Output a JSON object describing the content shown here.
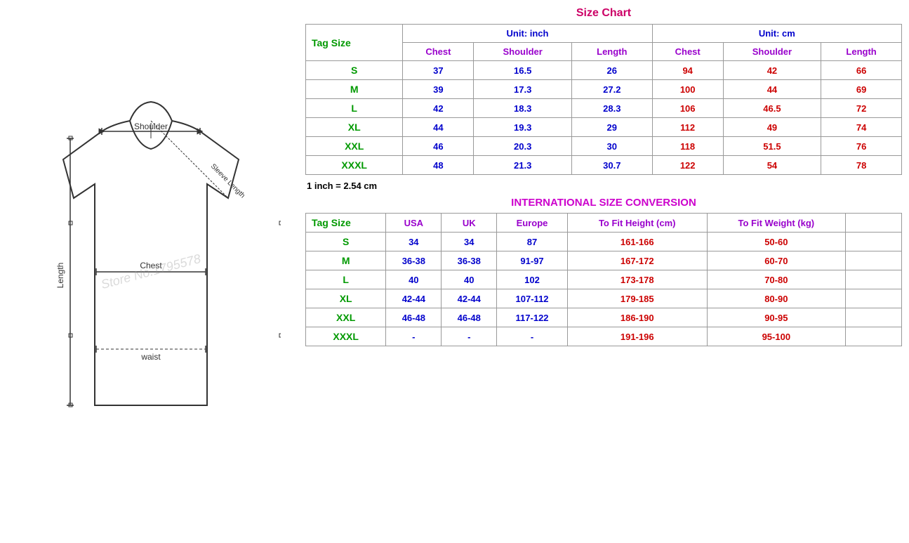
{
  "left": {
    "diagram_alt": "T-shirt size diagram"
  },
  "right": {
    "size_chart_title": "Size Chart",
    "unit_inch": "Unit: inch",
    "unit_cm": "Unit: cm",
    "tag_size_label": "Tag Size",
    "inch_note": "1 inch = 2.54 cm",
    "columns_inch": [
      "Chest",
      "Shoulder",
      "Length"
    ],
    "columns_cm": [
      "Chest",
      "Shoulder",
      "Length"
    ],
    "size_rows": [
      {
        "tag": "S",
        "chest_in": "37",
        "shoulder_in": "16.5",
        "length_in": "26",
        "chest_cm": "94",
        "shoulder_cm": "42",
        "length_cm": "66"
      },
      {
        "tag": "M",
        "chest_in": "39",
        "shoulder_in": "17.3",
        "length_in": "27.2",
        "chest_cm": "100",
        "shoulder_cm": "44",
        "length_cm": "69"
      },
      {
        "tag": "L",
        "chest_in": "42",
        "shoulder_in": "18.3",
        "length_in": "28.3",
        "chest_cm": "106",
        "shoulder_cm": "46.5",
        "length_cm": "72"
      },
      {
        "tag": "XL",
        "chest_in": "44",
        "shoulder_in": "19.3",
        "length_in": "29",
        "chest_cm": "112",
        "shoulder_cm": "49",
        "length_cm": "74"
      },
      {
        "tag": "XXL",
        "chest_in": "46",
        "shoulder_in": "20.3",
        "length_in": "30",
        "chest_cm": "118",
        "shoulder_cm": "51.5",
        "length_cm": "76"
      },
      {
        "tag": "XXXL",
        "chest_in": "48",
        "shoulder_in": "21.3",
        "length_in": "30.7",
        "chest_cm": "122",
        "shoulder_cm": "54",
        "length_cm": "78"
      }
    ],
    "intl_title": "INTERNATIONAL SIZE CONVERSION",
    "intl_columns": [
      "USA",
      "UK",
      "Europe",
      "To Fit Height (cm)",
      "To Fit Weight (kg)"
    ],
    "intl_rows": [
      {
        "tag": "S",
        "usa": "34",
        "uk": "34",
        "europe": "87",
        "height": "161-166",
        "weight": "50-60"
      },
      {
        "tag": "M",
        "usa": "36-38",
        "uk": "36-38",
        "europe": "91-97",
        "height": "167-172",
        "weight": "60-70"
      },
      {
        "tag": "L",
        "usa": "40",
        "uk": "40",
        "europe": "102",
        "height": "173-178",
        "weight": "70-80"
      },
      {
        "tag": "XL",
        "usa": "42-44",
        "uk": "42-44",
        "europe": "107-112",
        "height": "179-185",
        "weight": "80-90"
      },
      {
        "tag": "XXL",
        "usa": "46-48",
        "uk": "46-48",
        "europe": "117-122",
        "height": "186-190",
        "weight": "90-95"
      },
      {
        "tag": "XXXL",
        "usa": "-",
        "uk": "-",
        "europe": "-",
        "height": "191-196",
        "weight": "95-100"
      }
    ],
    "watermark": "Store No.1795578"
  }
}
